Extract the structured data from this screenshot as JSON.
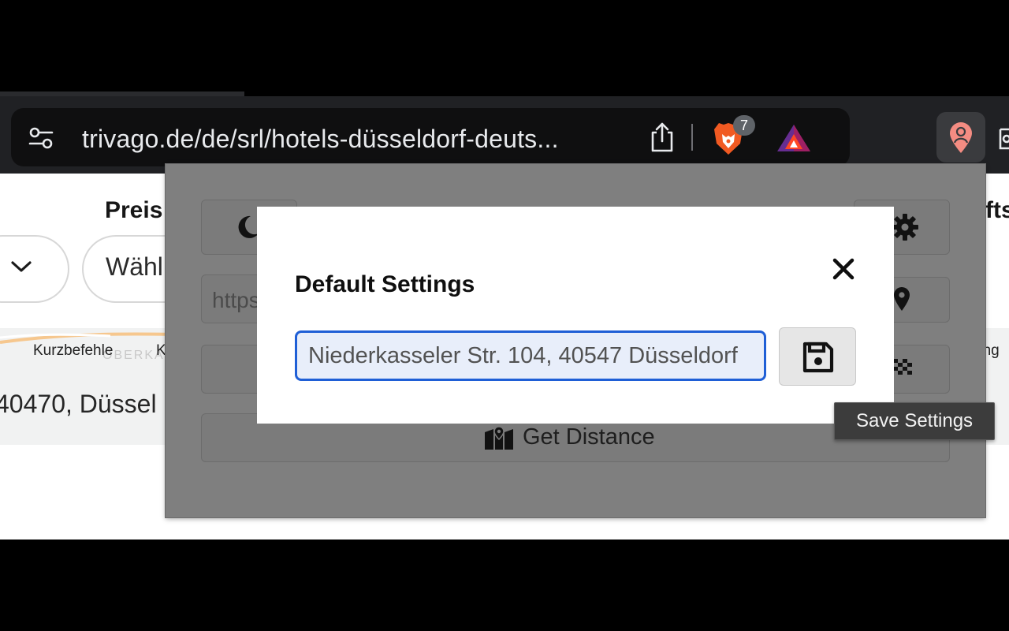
{
  "browser": {
    "url": "trivago.de/de/srl/hotels-düsseldorf-deuts...",
    "shields_badge_count": "7"
  },
  "background_page": {
    "filter_label": "Preis",
    "filter_label_right": "fts",
    "select_placeholder": "Wähl",
    "map_label_shortcuts": "Kurzbefehle",
    "map_label_partial": "K",
    "map_label_faded": "OBERKA",
    "map_label_right": "ung",
    "address_partial": "40470, Düssel"
  },
  "popup": {
    "url_field_partial": "https",
    "distance_button_label": "Get Distance"
  },
  "modal": {
    "title": "Default Settings",
    "address_value": "Niederkasseler Str. 104, 40547 Düsseldorf",
    "close_symbol": "✕"
  },
  "tooltip": {
    "text": "Save Settings"
  },
  "icons": {
    "site_settings": "tune-icon",
    "share": "share-icon",
    "brave_shields": "brave-lion-icon",
    "brave_rewards": "brave-rewards-icon",
    "extension": "person-pin-icon",
    "moon": "moon-icon",
    "gear": "gear-icon",
    "pin": "map-pin-icon",
    "flag": "checkered-flag-icon",
    "map": "map-icon",
    "save": "floppy-disk-icon"
  },
  "colors": {
    "focus_border": "#1f5fd6",
    "popup_overlay": "#7f7f7f",
    "brave_orange": "#f15a22",
    "toolbar": "#202124"
  }
}
